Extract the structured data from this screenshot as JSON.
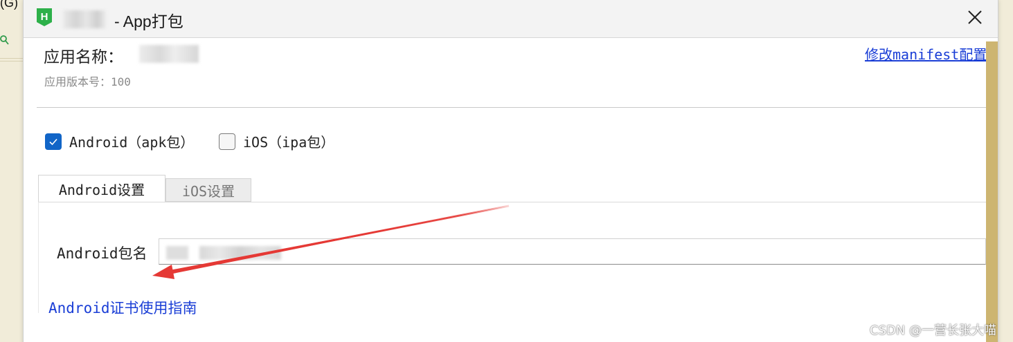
{
  "background": {
    "fragment_text": "(G)"
  },
  "dialog": {
    "title": "- App打包",
    "app_name_label": "应用名称：",
    "app_version": "应用版本号：100",
    "manifest_link": "修改manifest配置",
    "platforms": {
      "android": {
        "label": "Android（apk包）",
        "checked": true
      },
      "ios": {
        "label": "iOS（ipa包）",
        "checked": false
      }
    },
    "tabs": [
      {
        "label": "Android设置",
        "active": true
      },
      {
        "label": "iOS设置",
        "active": false
      }
    ],
    "android_package_label": "Android包名",
    "certificate_guide_link": "Android证书使用指南"
  },
  "colors": {
    "accent_blue": "#1165c7",
    "link_blue": "#1a3ed6",
    "scrollbar": "#cdb571",
    "arrow_red": "#e53935",
    "hbuilder_green": "#2db04a"
  },
  "watermark": "CSDN @一营长张大喵"
}
